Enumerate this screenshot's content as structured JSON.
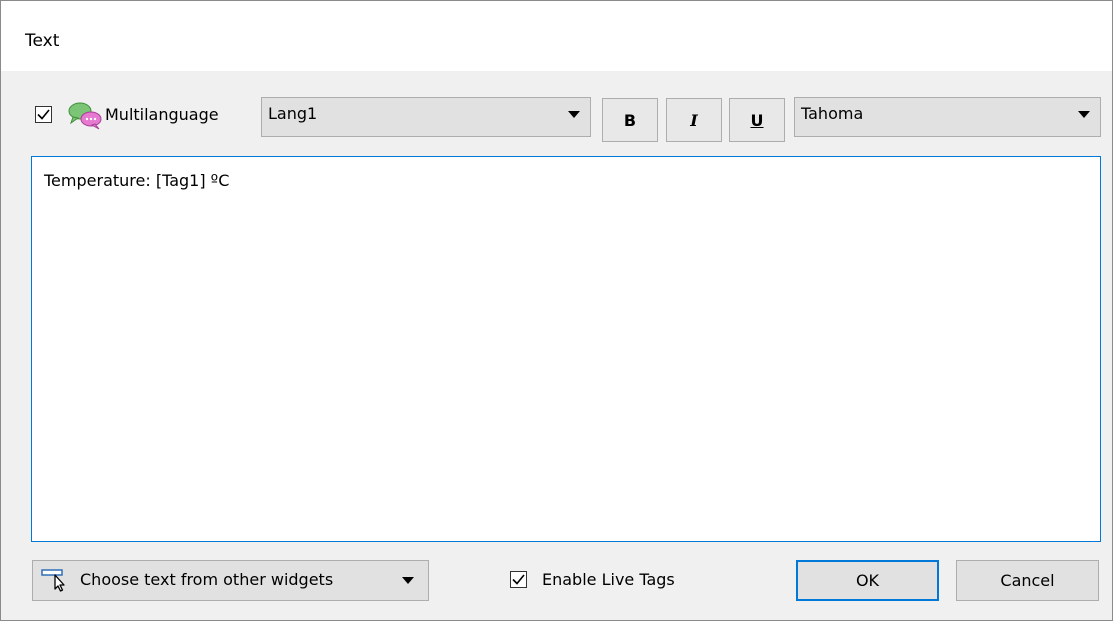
{
  "window": {
    "title": "Text"
  },
  "toolbar": {
    "multilanguage_checked": true,
    "multilanguage_label": "Multilanguage",
    "multilanguage_icon": "chat-bubbles-icon",
    "language_selected": "Lang1",
    "bold_label": "B",
    "italic_label": "I",
    "underline_label": "U",
    "font_selected": "Tahoma"
  },
  "editor": {
    "content": "Temperature: [Tag1] ºC"
  },
  "footer": {
    "choose_label": "Choose text from other widgets",
    "choose_icon": "widget-pointer-icon",
    "live_tags_checked": true,
    "live_tags_label": "Enable Live Tags",
    "ok_label": "OK",
    "cancel_label": "Cancel"
  },
  "colors": {
    "accent": "#0078d7",
    "background": "#f0f0f0",
    "button_face": "#e1e1e1"
  }
}
